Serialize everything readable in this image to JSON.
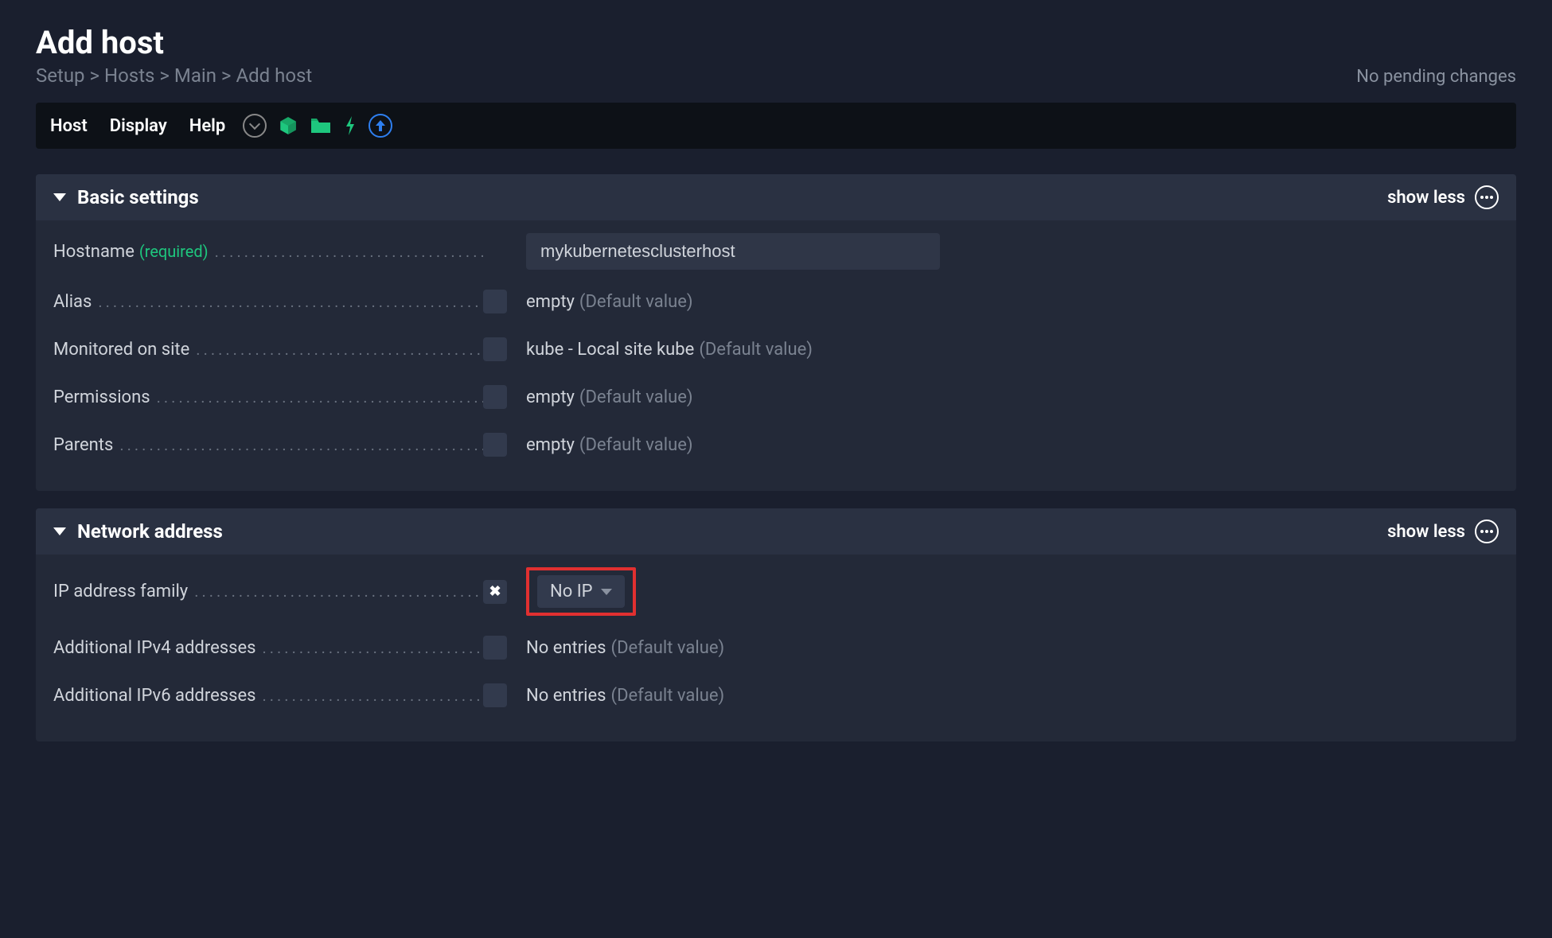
{
  "header": {
    "title": "Add host",
    "breadcrumb": "Setup > Hosts > Main > Add host",
    "pending": "No pending changes"
  },
  "toolbar": {
    "host": "Host",
    "display": "Display",
    "help": "Help"
  },
  "sections": {
    "basic": {
      "title": "Basic settings",
      "toggle": "show less"
    },
    "network": {
      "title": "Network address",
      "toggle": "show less"
    }
  },
  "fields": {
    "hostname": {
      "label": "Hostname",
      "required": "(required)",
      "value": "mykubernetesclusterhost"
    },
    "alias": {
      "label": "Alias",
      "value": "empty",
      "default": "(Default value)"
    },
    "monitored": {
      "label": "Monitored on site",
      "value": "kube - Local site kube",
      "default": "(Default value)"
    },
    "permissions": {
      "label": "Permissions",
      "value": "empty",
      "default": "(Default value)"
    },
    "parents": {
      "label": "Parents",
      "value": "empty",
      "default": "(Default value)"
    },
    "ipfamily": {
      "label": "IP address family",
      "value": "No IP"
    },
    "ipv4": {
      "label": "Additional IPv4 addresses",
      "value": "No entries",
      "default": "(Default value)"
    },
    "ipv6": {
      "label": "Additional IPv6 addresses",
      "value": "No entries",
      "default": "(Default value)"
    }
  },
  "dots": "........................................................."
}
